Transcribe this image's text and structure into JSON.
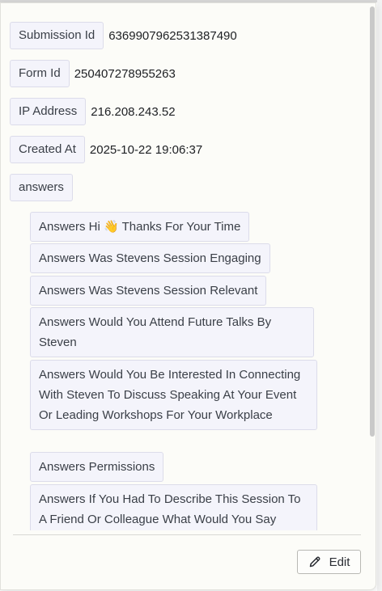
{
  "fields": [
    {
      "key": "Submission Id",
      "value": "6369907962531387490"
    },
    {
      "key": "Form Id",
      "value": "250407278955263"
    },
    {
      "key": "IP Address",
      "value": "216.208.243.52"
    },
    {
      "key": "Created At",
      "value": "2025-10-22 19:06:37"
    }
  ],
  "answers_key": "answers",
  "answers": [
    {
      "label": "Answers Hi 👋 Thanks For Your Time"
    },
    {
      "label": "Answers Was Stevens Session Engaging"
    },
    {
      "label": "Answers Was Stevens Session Relevant"
    },
    {
      "label": "Answers Would You Attend Future Talks By Steven"
    },
    {
      "label": "Answers Would You Be Interested In Connecting With Steven To Discuss Speaking At Your Event Or Leading Workshops For Your Workplace"
    },
    {
      "label": "Answers Permissions"
    },
    {
      "label": "Answers If You Had To Describe This Session To A Friend Or Colleague What Would You Say"
    }
  ],
  "footer": {
    "edit_label": "Edit",
    "edit_icon": "pencil-icon"
  }
}
